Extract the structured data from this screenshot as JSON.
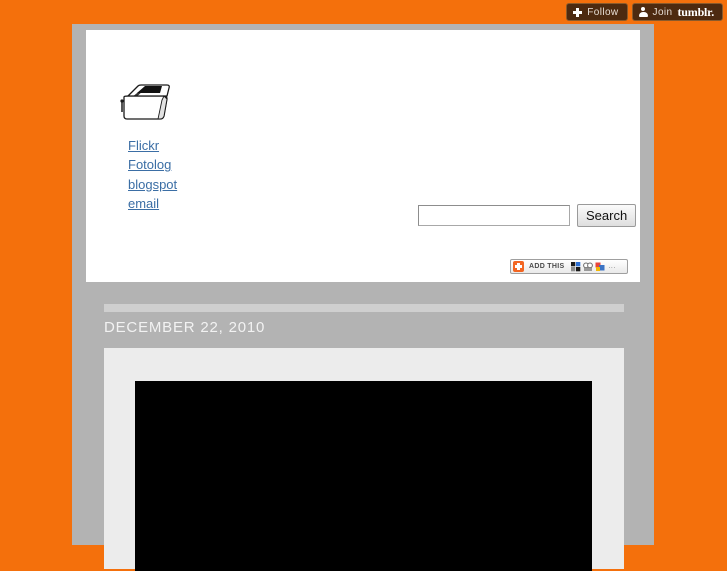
{
  "tumblr_bar": {
    "follow": {
      "label": "Follow",
      "icon": "plus-icon"
    },
    "join": {
      "prefix": "Join",
      "brand": "tumblr.",
      "icon": "person-icon"
    }
  },
  "header": {
    "logo_alt": "toaster-logo",
    "links": [
      {
        "label": "Flickr"
      },
      {
        "label": "Fotolog"
      },
      {
        "label": "blogspot"
      },
      {
        "label": "email"
      }
    ],
    "search": {
      "value": "",
      "placeholder": "",
      "button_label": "Search"
    },
    "addthis": {
      "label": "ADD THIS",
      "more": "...",
      "icons": [
        "windows-icon",
        "friendfeed-icon",
        "share-icon"
      ]
    }
  },
  "post": {
    "date": "DECEMBER 22, 2010",
    "media_type": "black-image"
  },
  "colors": {
    "background": "#f4700c",
    "container": "#b3b3b3",
    "panel": "#ffffff",
    "post_box": "#ececec",
    "divider": "#cfcfcf",
    "link": "#3b6ea5",
    "date_text": "#f2f2f2",
    "addthis_orange": "#f26522",
    "tumblr_button": "#4d2a10"
  }
}
